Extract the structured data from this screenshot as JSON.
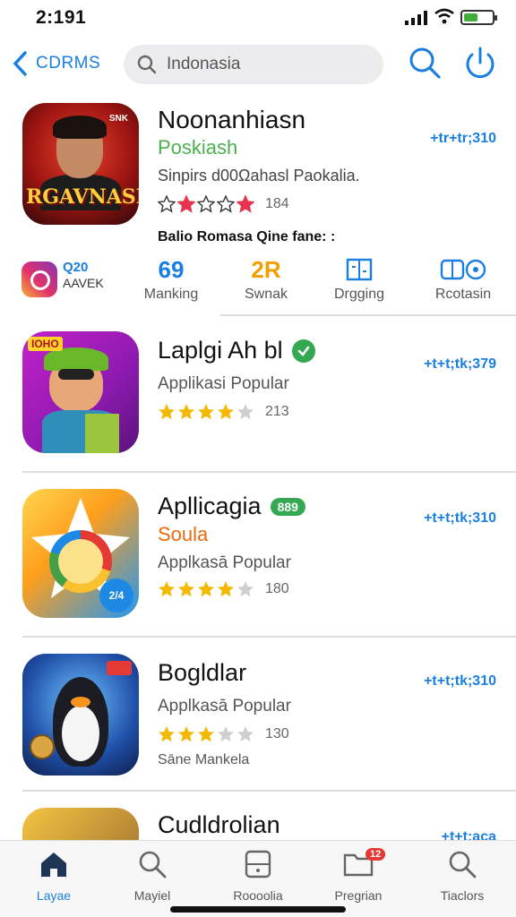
{
  "status": {
    "time": "2:191"
  },
  "nav": {
    "back_label": "CDRMS",
    "search_value": "Indonasia"
  },
  "featured": {
    "title": "Noonanhiasn",
    "subtitle": "Poskiash",
    "description": "Sinpirs d00Ωahasl Paokalia.",
    "rating": 2,
    "rating_count": "184",
    "price": "+tr+tr;310",
    "note": "Balio Romasa Qine fane: :",
    "icon_logo": "RGAVNASIA",
    "icon_tag": "SNK"
  },
  "categories": {
    "promo_line1": "Q20",
    "promo_line2": "AAVEK",
    "items": [
      {
        "glyph": "69",
        "label": "Manking"
      },
      {
        "glyph": "2R",
        "label": "Swnak"
      },
      {
        "glyph": "",
        "label": "Drgging"
      },
      {
        "glyph": "",
        "label": "Rcotasin"
      }
    ]
  },
  "apps": [
    {
      "title": "Laplgi Ah bl",
      "category": "Applikasi Popular",
      "rating": 4,
      "rating_count": "213",
      "price": "+t+t;tk;379",
      "verified": true,
      "icon_badge": "IOHO"
    },
    {
      "title": "Apllicagia",
      "badge": "889",
      "subtitle": "Soula",
      "category": "Applkasā Popular",
      "rating": 4,
      "rating_count": "180",
      "price": "+t+t;tk;310",
      "icon_badge": "2/4"
    },
    {
      "title": "Bogldlar",
      "category": "Applkasā Popular",
      "rating": 3,
      "rating_count": "130",
      "price": "+t+t;tk;310",
      "extra": "Sāne Mankela"
    },
    {
      "title": "Cudldrolian",
      "price": "+t+t;aca"
    }
  ],
  "tabs": [
    {
      "label": "Layae",
      "icon": "home-icon",
      "active": true
    },
    {
      "label": "Mayiel",
      "icon": "search-icon",
      "active": false
    },
    {
      "label": "Roooolia",
      "icon": "device-icon",
      "active": false
    },
    {
      "label": "Pregrian",
      "icon": "folder-icon",
      "active": false,
      "notification": "12"
    },
    {
      "label": "Tiaclors",
      "icon": "search-icon",
      "active": false
    }
  ],
  "colors": {
    "accent": "#1a7fe0",
    "green": "#4caf50",
    "star": "#f5b800",
    "star_red": "#e8334f"
  }
}
